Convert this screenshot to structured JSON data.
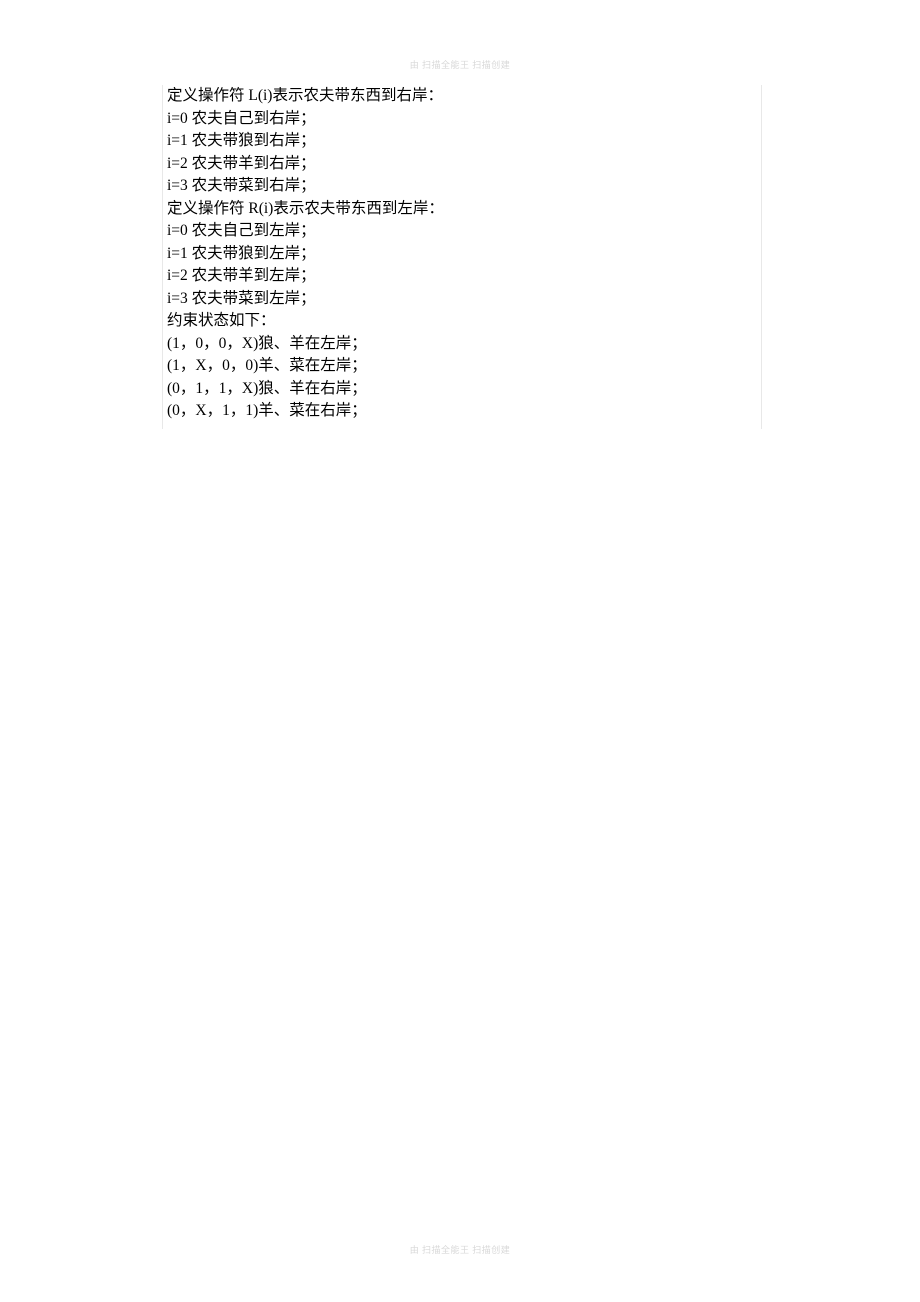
{
  "watermark": "由 扫描全能王 扫描创建",
  "lines": [
    "定义操作符 L(i)表示农夫带东西到右岸：",
    "i=0 农夫自己到右岸；",
    "i=1 农夫带狼到右岸；",
    "i=2 农夫带羊到右岸；",
    "i=3 农夫带菜到右岸；",
    "定义操作符 R(i)表示农夫带东西到左岸：",
    "i=0 农夫自己到左岸；",
    "i=1 农夫带狼到左岸；",
    "i=2 农夫带羊到左岸；",
    "i=3 农夫带菜到左岸；",
    "约束状态如下：",
    "(1，0，0，X)狼、羊在左岸；",
    "(1，X，0，0)羊、菜在左岸；",
    "(0，1，1，X)狼、羊在右岸；",
    "(0，X，1，1)羊、菜在右岸；"
  ]
}
